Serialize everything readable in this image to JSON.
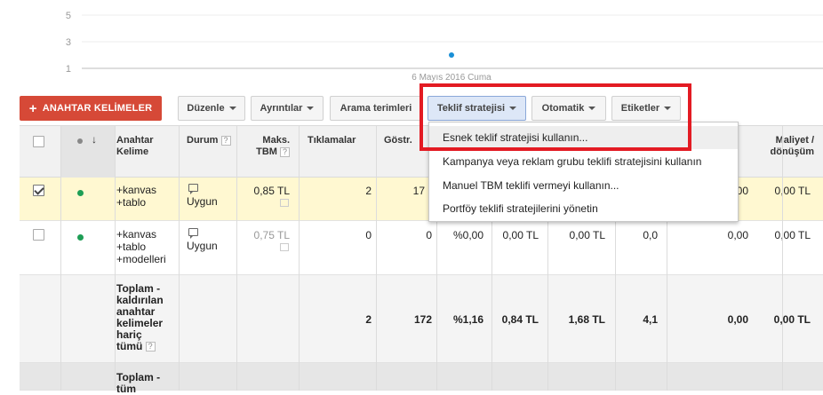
{
  "chart": {
    "y_ticks": [
      "5",
      "3",
      "1"
    ],
    "date_label": "6 Mayıs 2016 Cuma",
    "point_color": "#1a8fd6"
  },
  "chart_data": {
    "type": "scatter",
    "x": [
      "6 Mayıs 2016 Cuma"
    ],
    "y": [
      2
    ],
    "y_ticks": [
      1,
      3,
      5
    ],
    "ylim": [
      1,
      5
    ],
    "grid": true
  },
  "toolbar": {
    "add_keywords_label": "ANAHTAR KELİMELER",
    "buttons": [
      {
        "label": "Düzenle",
        "dropdown": true
      },
      {
        "label": "Ayrıntılar",
        "dropdown": true
      },
      {
        "label": "Arama terimleri",
        "dropdown": false
      },
      {
        "label": "Teklif stratejisi",
        "dropdown": true
      },
      {
        "label": "Otomatik",
        "dropdown": true
      },
      {
        "label": "Etiketler",
        "dropdown": true
      }
    ]
  },
  "table": {
    "headers": {
      "keyword": "Anahtar Kelime",
      "status": "Durum",
      "max_cpc": "Maks. TBM",
      "clicks": "Tıklamalar",
      "impressions": "Göstr.",
      "cost_per_conversion": "Maliyet / dönüşüm"
    },
    "rows": [
      {
        "checked": true,
        "keyword": [
          "+kanvas",
          "+tablo"
        ],
        "status": "Uygun",
        "max_cpc": "0,85 TL",
        "clicks": "2",
        "impressions": "17",
        "ctr": "",
        "avg_cpc": "",
        "cost": "",
        "avg_pos": "",
        "conversions": "0,00",
        "cost_per_conversion": "0,00 TL"
      },
      {
        "checked": false,
        "keyword": [
          "+kanvas",
          "+tablo",
          "+modelleri"
        ],
        "status": "Uygun",
        "max_cpc": "0,75 TL",
        "clicks": "0",
        "impressions": "0",
        "ctr": "%0,00",
        "avg_cpc": "0,00 TL",
        "cost": "0,00 TL",
        "avg_pos": "0,0",
        "conversions": "0,00",
        "cost_per_conversion": "0,00 TL"
      }
    ],
    "total_removed": {
      "label": [
        "Toplam -",
        "kaldırılan",
        "anahtar",
        "kelimeler",
        "hariç",
        "tümü"
      ],
      "clicks": "2",
      "impressions": "172",
      "ctr": "%1,16",
      "avg_cpc": "0,84 TL",
      "cost": "1,68 TL",
      "avg_pos": "4,1",
      "conversions": "0,00",
      "cost_per_conversion": "0,00 TL"
    },
    "total_all": {
      "label": [
        "Toplam -",
        "tüm"
      ]
    }
  },
  "bid_strategy_menu": {
    "items": [
      "Esnek teklif stratejisi kullanın...",
      "Kampanya veya reklam grubu teklifi stratejisini kullanın",
      "Manuel TBM teklifi vermeyi kullanın...",
      "Portföy teklifi stratejilerini yönetin"
    ]
  },
  "colors": {
    "add_button": "#d64937",
    "selected_row": "#fff8d1",
    "status_dot": "#1e9e55",
    "annotation": "#e31b23"
  }
}
